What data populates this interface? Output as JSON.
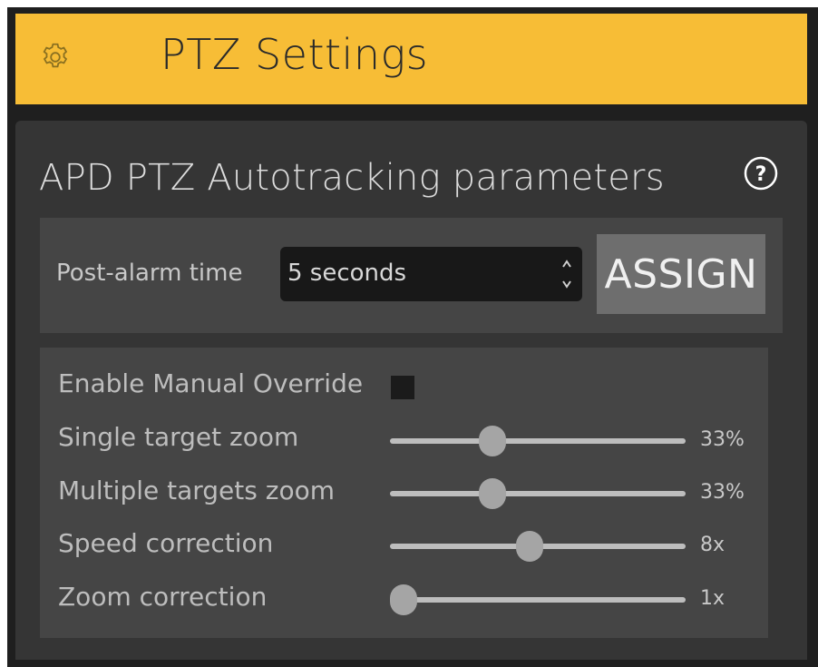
{
  "header": {
    "title": "PTZ Settings",
    "icon": "gear-icon",
    "color": "#f7bd36"
  },
  "panel": {
    "title": "APD PTZ Autotracking parameters",
    "help_icon": "help-icon",
    "help_symbol": "?"
  },
  "post_alarm": {
    "label": "Post-alarm time",
    "value": "5 seconds",
    "assign_label": "ASSIGN"
  },
  "override": {
    "label": "Enable Manual Override",
    "checked": false
  },
  "sliders": [
    {
      "label": "Single target zoom",
      "value": "33%",
      "level": 0.33
    },
    {
      "label": "Multiple targets zoom",
      "value": "33%",
      "level": 0.33
    },
    {
      "label": "Speed correction",
      "value": "8x",
      "level": 0.47
    },
    {
      "label": "Zoom correction",
      "value": "1x",
      "level": 0.0
    }
  ]
}
